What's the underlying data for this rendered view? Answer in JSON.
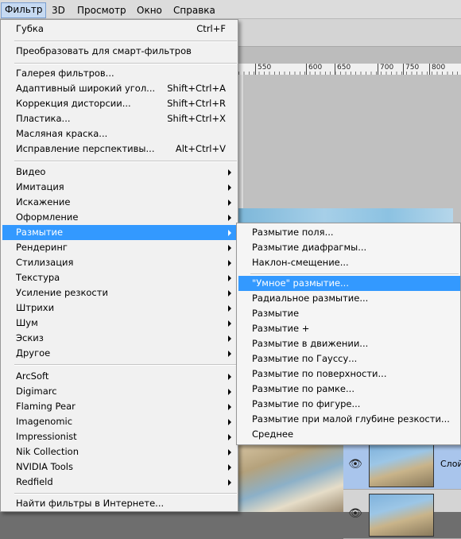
{
  "menubar": {
    "items": [
      {
        "label": "Фильтр",
        "active": true
      },
      {
        "label": "3D"
      },
      {
        "label": "Просмотр"
      },
      {
        "label": "Окно"
      },
      {
        "label": "Справка"
      }
    ]
  },
  "ruler": {
    "labels": [
      "550",
      "600",
      "650",
      "700",
      "750",
      "800"
    ]
  },
  "filter_menu": {
    "group1": [
      {
        "label": "Губка",
        "shortcut": "Ctrl+F"
      }
    ],
    "group2": [
      {
        "label": "Преобразовать для смарт-фильтров"
      }
    ],
    "group3": [
      {
        "label": "Галерея фильтров..."
      },
      {
        "label": "Адаптивный широкий угол...",
        "shortcut": "Shift+Ctrl+A"
      },
      {
        "label": "Коррекция дисторсии...",
        "shortcut": "Shift+Ctrl+R"
      },
      {
        "label": "Пластика...",
        "shortcut": "Shift+Ctrl+X"
      },
      {
        "label": "Масляная краска..."
      },
      {
        "label": "Исправление перспективы...",
        "shortcut": "Alt+Ctrl+V"
      }
    ],
    "group4": [
      {
        "label": "Видео"
      },
      {
        "label": "Имитация"
      },
      {
        "label": "Искажение"
      },
      {
        "label": "Оформление"
      },
      {
        "label": "Размытие",
        "highlighted": true
      },
      {
        "label": "Рендеринг"
      },
      {
        "label": "Стилизация"
      },
      {
        "label": "Текстура"
      },
      {
        "label": "Усиление резкости"
      },
      {
        "label": "Штрихи"
      },
      {
        "label": "Шум"
      },
      {
        "label": "Эскиз"
      },
      {
        "label": "Другое"
      }
    ],
    "group5": [
      {
        "label": "ArcSoft"
      },
      {
        "label": "Digimarc"
      },
      {
        "label": "Flaming Pear"
      },
      {
        "label": "Imagenomic"
      },
      {
        "label": "Impressionist"
      },
      {
        "label": "Nik Collection"
      },
      {
        "label": "NVIDIA Tools"
      },
      {
        "label": "Redfield"
      }
    ],
    "group6": [
      {
        "label": "Найти фильтры в Интернете..."
      }
    ]
  },
  "blur_menu": {
    "group1": [
      {
        "label": "Размытие поля..."
      },
      {
        "label": "Размытие диафрагмы..."
      },
      {
        "label": "Наклон-смещение..."
      }
    ],
    "group2": [
      {
        "label": "\"Умное\" размытие...",
        "highlighted": true
      },
      {
        "label": "Радиальное размытие..."
      },
      {
        "label": "Размытие"
      },
      {
        "label": "Размытие +"
      },
      {
        "label": "Размытие в движении..."
      },
      {
        "label": "Размытие по Гауссу..."
      },
      {
        "label": "Размытие по поверхности..."
      },
      {
        "label": "Размытие по рамке..."
      },
      {
        "label": "Размытие по фигуре..."
      },
      {
        "label": "Размытие при малой глубине резкости..."
      },
      {
        "label": "Среднее"
      }
    ]
  },
  "layers": {
    "rows": [
      {
        "name": "Слой",
        "selected": true,
        "thumb_icon": "landscape-thumbnail",
        "eye_icon": "eye-icon"
      },
      {
        "name": "",
        "selected": false,
        "thumb_icon": "landscape-thumbnail",
        "eye_icon": "eye-icon"
      }
    ]
  },
  "colors": {
    "highlight": "#3399ff",
    "menu_bg": "#f5f5f5",
    "menubar_active": "#c6daf2"
  }
}
